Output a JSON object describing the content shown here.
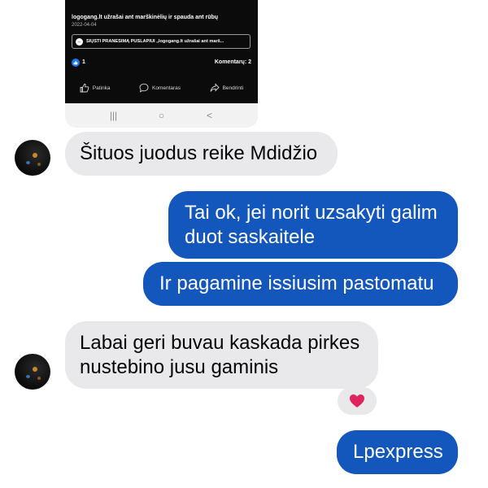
{
  "shared_post": {
    "title": "logogang.lt užrašai ant marškinėlių ir spauda ant rūbų",
    "date": "2022-04-04",
    "send_button_label": "SIŲSTI PRANEŠIMĄ PUSLAPIUI „logogang.lt užrašai ant marš...",
    "like_count": "1",
    "comments_count": "Komentarų: 2",
    "actions": {
      "like": "Patinka",
      "comment": "Komentaras",
      "share": "Bendrinti"
    },
    "nav": {
      "recents": "|||",
      "home": "○",
      "back": "<"
    }
  },
  "messages": [
    {
      "sender": "contact",
      "text": "Šituos juodus reike Mdidžio"
    },
    {
      "sender": "me",
      "lines": [
        "Tai ok, jei norit uzsakyti galim",
        "duot saskaitele"
      ]
    },
    {
      "sender": "me",
      "text": "Ir pagamine issiusim pastomatu"
    },
    {
      "sender": "contact",
      "lines": [
        "Labai geri buvau kaskada pirkes",
        "nustebino jusu gaminis"
      ],
      "reaction": "heart"
    },
    {
      "sender": "me",
      "text": "Lpexpress"
    }
  ],
  "colors": {
    "outgoing_bubble": "#1357bd",
    "incoming_bubble": "#e9e9eb",
    "reaction_heart": "#e0245e"
  },
  "icons": [
    "messenger-icon",
    "like-icon",
    "thumbs-up-icon",
    "comment-icon",
    "share-icon",
    "heart-icon"
  ]
}
